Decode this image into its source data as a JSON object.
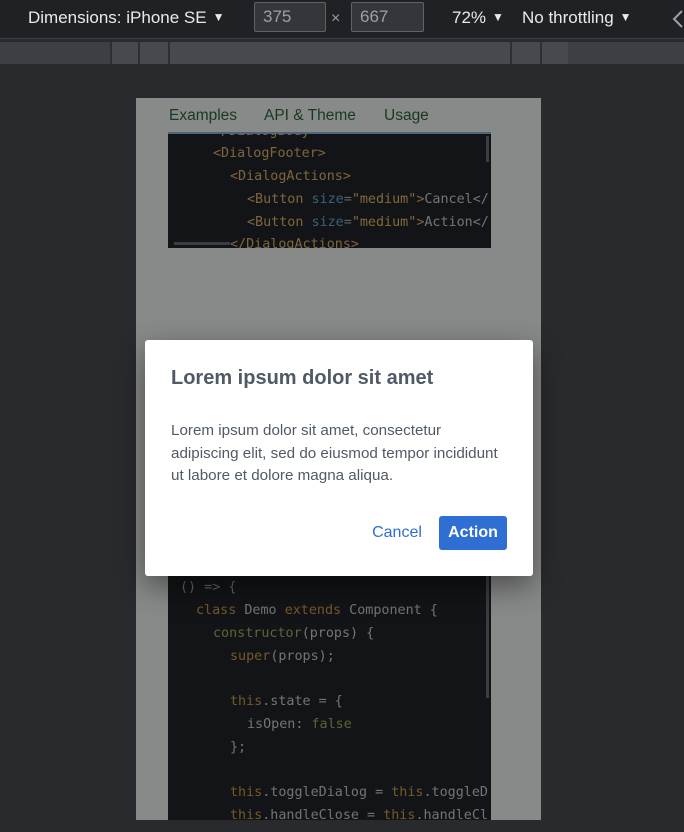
{
  "devtools": {
    "dimensions_label": "Dimensions: iPhone SE",
    "width_value": "375",
    "height_value": "667",
    "times_symbol": "×",
    "zoom_label": "72%",
    "throttling_label": "No throttling",
    "caret": "▼"
  },
  "page": {
    "tabs": [
      "Examples",
      "API & Theme",
      "Usage"
    ]
  },
  "code_top": {
    "line0": "</DialogBody>",
    "line1_tag": "<DialogFooter>",
    "line2_tag": "<DialogActions>",
    "line3": {
      "open": "<Button ",
      "attr": "size",
      "eq": "=",
      "str": "\"medium\"",
      "close": ">",
      "text": "Cancel</"
    },
    "line4": {
      "open": "<Button ",
      "attr": "size",
      "eq": "=",
      "str": "\"medium\"",
      "close": ">",
      "text": "Action</"
    },
    "line5": "</DialogActions>"
  },
  "code_bottom": {
    "l1": "() => {",
    "l2_kw": "class",
    "l2_name": " Demo ",
    "l2_kw2": "extends",
    "l2_rest": " Component {",
    "l3_fn": "constructor",
    "l3_rest": "(props) {",
    "l4_fn": "super",
    "l4_rest": "(props);",
    "l6_kw": "this",
    "l6_rest": ".state = {",
    "l7_key": "isOpen: ",
    "l7_val": "false",
    "l8": "};",
    "l10_kw": "this",
    "l10_mid": ".toggleDialog = ",
    "l10_kw2": "this",
    "l10_rest": ".toggleD",
    "l11_kw": "this",
    "l11_mid": ".handleClose = ",
    "l11_kw2": "this",
    "l11_rest": ".handleCl"
  },
  "dialog": {
    "title": "Lorem ipsum dolor sit amet",
    "body": "Lorem ipsum dolor sit amet, consectetur adipiscing elit, sed do eiusmod tempor incididunt ut labore et dolore magna aliqua.",
    "cancel_label": "Cancel",
    "action_label": "Action"
  },
  "colors": {
    "primary": "#2f6ed2",
    "toolbar_bg": "#202124",
    "code_bg": "#22252b"
  }
}
